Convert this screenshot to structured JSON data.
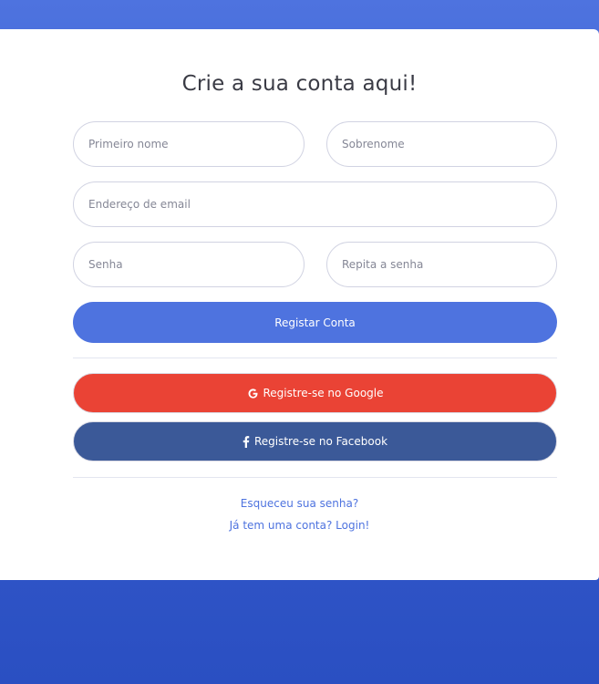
{
  "register": {
    "title": "Crie a sua conta aqui!",
    "first_name_placeholder": "Primeiro nome",
    "last_name_placeholder": "Sobrenome",
    "email_placeholder": "Endereço de email",
    "password_placeholder": "Senha",
    "repeat_password_placeholder": "Repita a senha",
    "submit_label": "Registar Conta",
    "google_label": "Registre-se no Google",
    "facebook_label": "Registre-se no Facebook",
    "forgot_password_link": "Esqueceu sua senha?",
    "login_link": "Já tem uma conta? Login!"
  },
  "icons": {
    "google": "google-icon",
    "facebook": "facebook-icon"
  },
  "colors": {
    "primary": "#4e73df",
    "google": "#ea4335",
    "facebook": "#3b5998",
    "background_bottom": "#2a4fc2"
  }
}
